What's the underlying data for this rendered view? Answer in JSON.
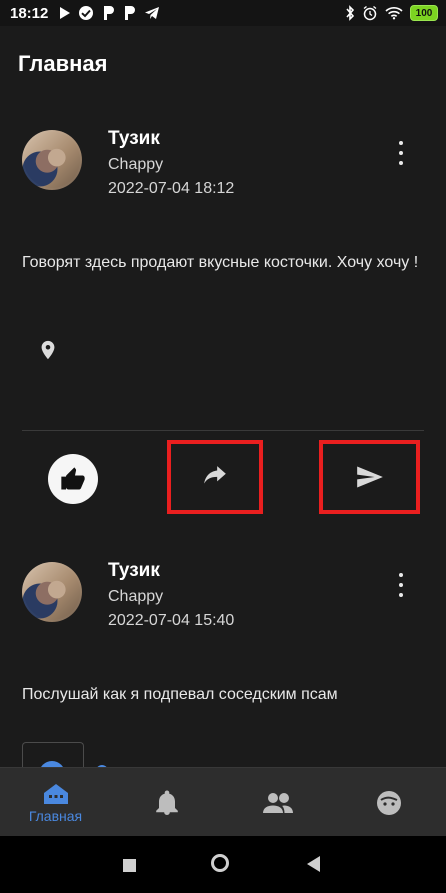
{
  "status_bar": {
    "time": "18:12",
    "battery": "100",
    "left_icons": [
      "play-icon",
      "checkmark-circle-icon",
      "p-icon",
      "p-icon",
      "telegram-icon"
    ],
    "right_icons": [
      "bluetooth-icon",
      "alarm-icon",
      "wifi-icon",
      "battery-icon"
    ]
  },
  "header": {
    "title": "Главная"
  },
  "posts": [
    {
      "author": "Тузик",
      "username": "Chappy",
      "timestamp": "2022-07-04 18:12",
      "text": "Говорят здесь продают вкусные косточки. Хочу хочу !"
    },
    {
      "author": "Тузик",
      "username": "Chappy",
      "timestamp": "2022-07-04 15:40",
      "text": "Послушай как я подпевал соседским псам"
    }
  ],
  "bottom_nav": {
    "items": [
      {
        "label": "Главная",
        "icon": "home-icon"
      },
      {
        "label": "",
        "icon": "bell-icon"
      },
      {
        "label": "",
        "icon": "people-icon"
      },
      {
        "label": "",
        "icon": "face-icon"
      }
    ]
  },
  "colors": {
    "background": "#1b1b1b",
    "accent": "#4a88df",
    "highlight": "#ea1f1f"
  }
}
